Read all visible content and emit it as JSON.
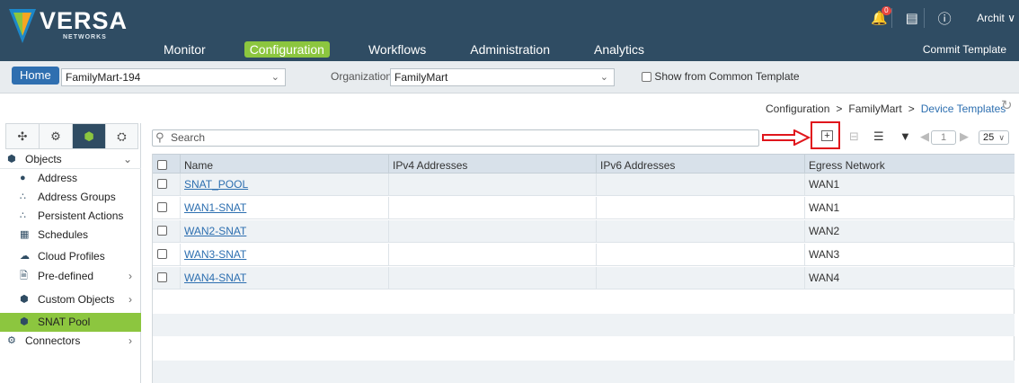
{
  "header": {
    "brand": "VERSA",
    "brand_sub": "NETWORKS",
    "nav": [
      "Monitor",
      "Configuration",
      "Workflows",
      "Administration",
      "Analytics"
    ],
    "active_nav": "Configuration",
    "notification_count": "0",
    "user": "Archit",
    "commit_template": "Commit Template"
  },
  "subbar": {
    "home": "Home",
    "appliance_value": "FamilyMart-194",
    "organization_label": "Organization:",
    "organization_value": "FamilyMart",
    "common_template_label": "Show from Common Template"
  },
  "breadcrumb": {
    "items": [
      "Configuration",
      "FamilyMart",
      "Device Templates"
    ],
    "separator": ">"
  },
  "sidebar": {
    "tabs": [
      "network-icon",
      "gear-icon",
      "cube-icon",
      "services-icon"
    ],
    "active_tab": 2,
    "items": [
      {
        "label": "Objects",
        "level": 0,
        "icon": "cube-icon",
        "chevron": "down"
      },
      {
        "label": "Address",
        "level": 1,
        "icon": "pin-icon"
      },
      {
        "label": "Address Groups",
        "level": 1,
        "icon": "group-icon"
      },
      {
        "label": "Persistent Actions",
        "level": 1,
        "icon": "group-icon"
      },
      {
        "label": "Schedules",
        "level": 1,
        "icon": "calendar-icon"
      },
      {
        "label": "Cloud Profiles",
        "level": 1,
        "icon": "cloud-icon"
      },
      {
        "label": "Pre-defined",
        "level": 1,
        "icon": "document-icon",
        "chevron": "right"
      },
      {
        "label": "Custom Objects",
        "level": 1,
        "icon": "cube-icon",
        "chevron": "right"
      },
      {
        "label": "SNAT Pool",
        "level": 1,
        "icon": "cube-icon",
        "active": true
      },
      {
        "label": "Connectors",
        "level": 0,
        "icon": "connectors-icon",
        "chevron": "right"
      }
    ]
  },
  "toolbar": {
    "search_placeholder": "Search",
    "page": "1",
    "per_page": "25"
  },
  "table": {
    "columns": [
      "Name",
      "IPv4 Addresses",
      "IPv6 Addresses",
      "Egress Network"
    ],
    "rows": [
      {
        "name": "SNAT_POOL",
        "ipv4": "",
        "ipv6": "",
        "egress": "WAN1"
      },
      {
        "name": "WAN1-SNAT",
        "ipv4": "",
        "ipv6": "",
        "egress": "WAN1"
      },
      {
        "name": "WAN2-SNAT",
        "ipv4": "",
        "ipv6": "",
        "egress": "WAN2"
      },
      {
        "name": "WAN3-SNAT",
        "ipv4": "",
        "ipv6": "",
        "egress": "WAN3"
      },
      {
        "name": "WAN4-SNAT",
        "ipv4": "",
        "ipv6": "",
        "egress": "WAN4"
      }
    ]
  },
  "colors": {
    "header_bg": "#2f4c63",
    "accent_green": "#8cc63f",
    "link_blue": "#2d6fb0",
    "highlight_red": "#e0161c"
  }
}
